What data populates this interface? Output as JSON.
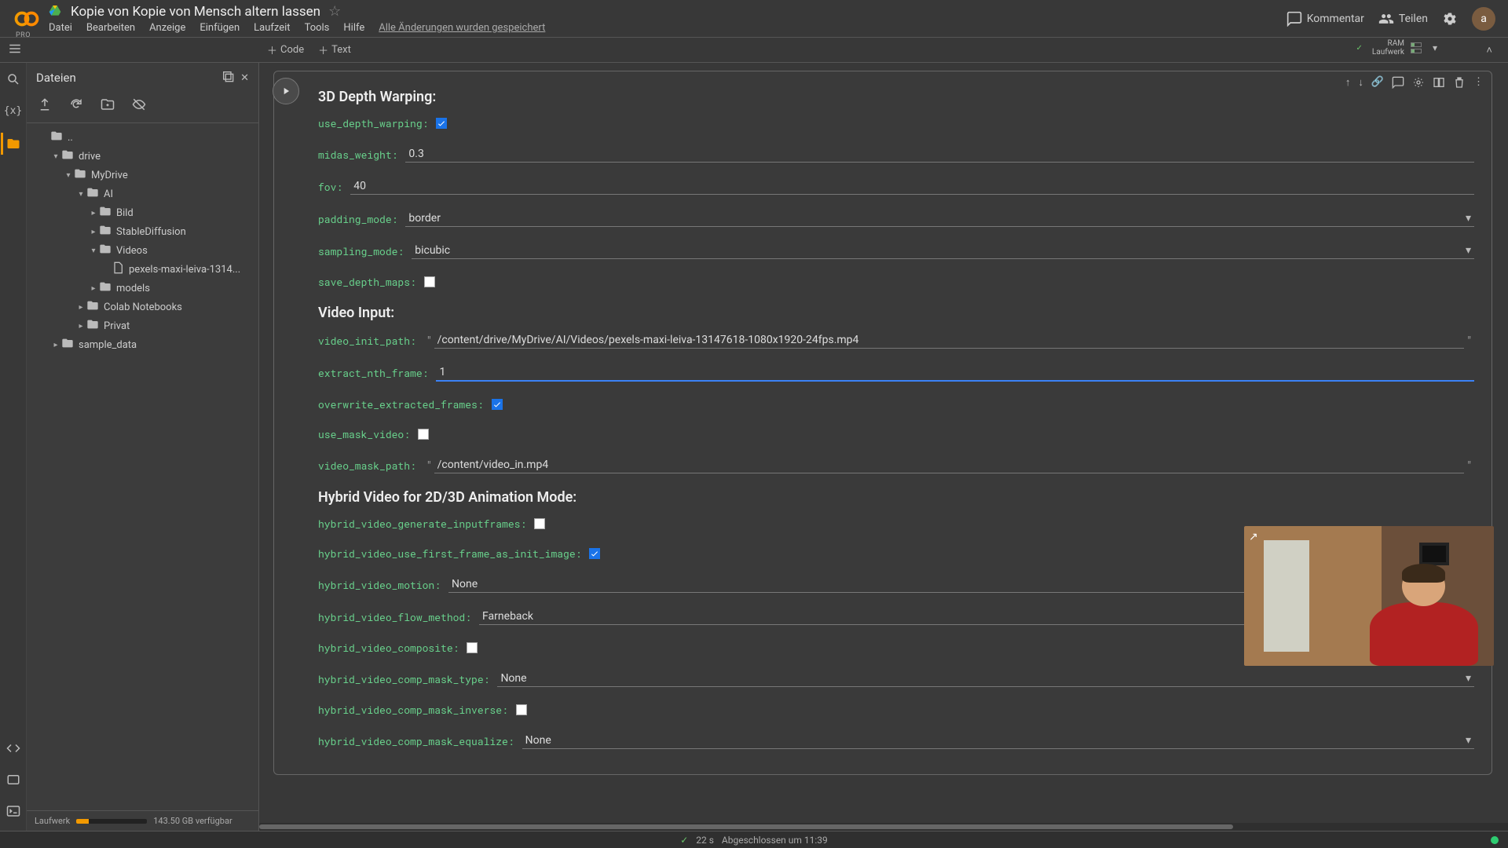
{
  "header": {
    "pro_label": "PRO",
    "title": "Kopie von Kopie von Mensch altern lassen",
    "menus": [
      "Datei",
      "Bearbeiten",
      "Anzeige",
      "Einfügen",
      "Laufzeit",
      "Tools",
      "Hilfe"
    ],
    "save_status": "Alle Änderungen wurden gespeichert",
    "comment": "Kommentar",
    "share": "Teilen",
    "avatar_letter": "a",
    "ram_line1": "RAM",
    "ram_line2": "Laufwerk"
  },
  "toolbar": {
    "code": "Code",
    "text": "Text"
  },
  "sidebar": {
    "title": "Dateien",
    "disk_label": "Laufwerk",
    "disk_free": "143.50 GB verfügbar",
    "tree": {
      "root_up": "..",
      "drive": "drive",
      "mydrive": "MyDrive",
      "ai": "AI",
      "bild": "Bild",
      "stablediff": "StableDiffusion",
      "videos": "Videos",
      "videofile": "pexels-maxi-leiva-1314...",
      "models": "models",
      "colab": "Colab Notebooks",
      "privat": "Privat",
      "sample": "sample_data"
    }
  },
  "sections": {
    "depth_warping": "3D Depth Warping:",
    "video_input": "Video Input:",
    "hybrid_video": "Hybrid Video for 2D/3D Animation Mode:"
  },
  "fields": {
    "use_depth_warping": {
      "label": "use_depth_warping:",
      "checked": true
    },
    "midas_weight": {
      "label": "midas_weight:",
      "value": "0.3"
    },
    "fov": {
      "label": "fov:",
      "value": "40"
    },
    "padding_mode": {
      "label": "padding_mode:",
      "value": "border"
    },
    "sampling_mode": {
      "label": "sampling_mode:",
      "value": "bicubic"
    },
    "save_depth_maps": {
      "label": "save_depth_maps:",
      "checked": false
    },
    "video_init_path": {
      "label": "video_init_path:",
      "value": "/content/drive/MyDrive/AI/Videos/pexels-maxi-leiva-13147618-1080x1920-24fps.mp4"
    },
    "extract_nth_frame": {
      "label": "extract_nth_frame:",
      "value": "1"
    },
    "overwrite_extracted_frames": {
      "label": "overwrite_extracted_frames:",
      "checked": true
    },
    "use_mask_video": {
      "label": "use_mask_video:",
      "checked": false
    },
    "video_mask_path": {
      "label": "video_mask_path:",
      "value": "/content/video_in.mp4"
    },
    "hybrid_video_generate_inputframes": {
      "label": "hybrid_video_generate_inputframes:",
      "checked": false
    },
    "hybrid_video_use_first_frame_as_init_image": {
      "label": "hybrid_video_use_first_frame_as_init_image:",
      "checked": true
    },
    "hybrid_video_motion": {
      "label": "hybrid_video_motion:",
      "value": "None"
    },
    "hybrid_video_flow_method": {
      "label": "hybrid_video_flow_method:",
      "value": "Farneback"
    },
    "hybrid_video_composite": {
      "label": "hybrid_video_composite:",
      "checked": false
    },
    "hybrid_video_comp_mask_type": {
      "label": "hybrid_video_comp_mask_type:",
      "value": "None"
    },
    "hybrid_video_comp_mask_inverse": {
      "label": "hybrid_video_comp_mask_inverse:",
      "checked": false
    },
    "hybrid_video_comp_mask_equalize": {
      "label": "hybrid_video_comp_mask_equalize:",
      "value": "None"
    }
  },
  "statusbar": {
    "seconds": "22 s",
    "done_at": "Abgeschlossen um 11:39"
  }
}
